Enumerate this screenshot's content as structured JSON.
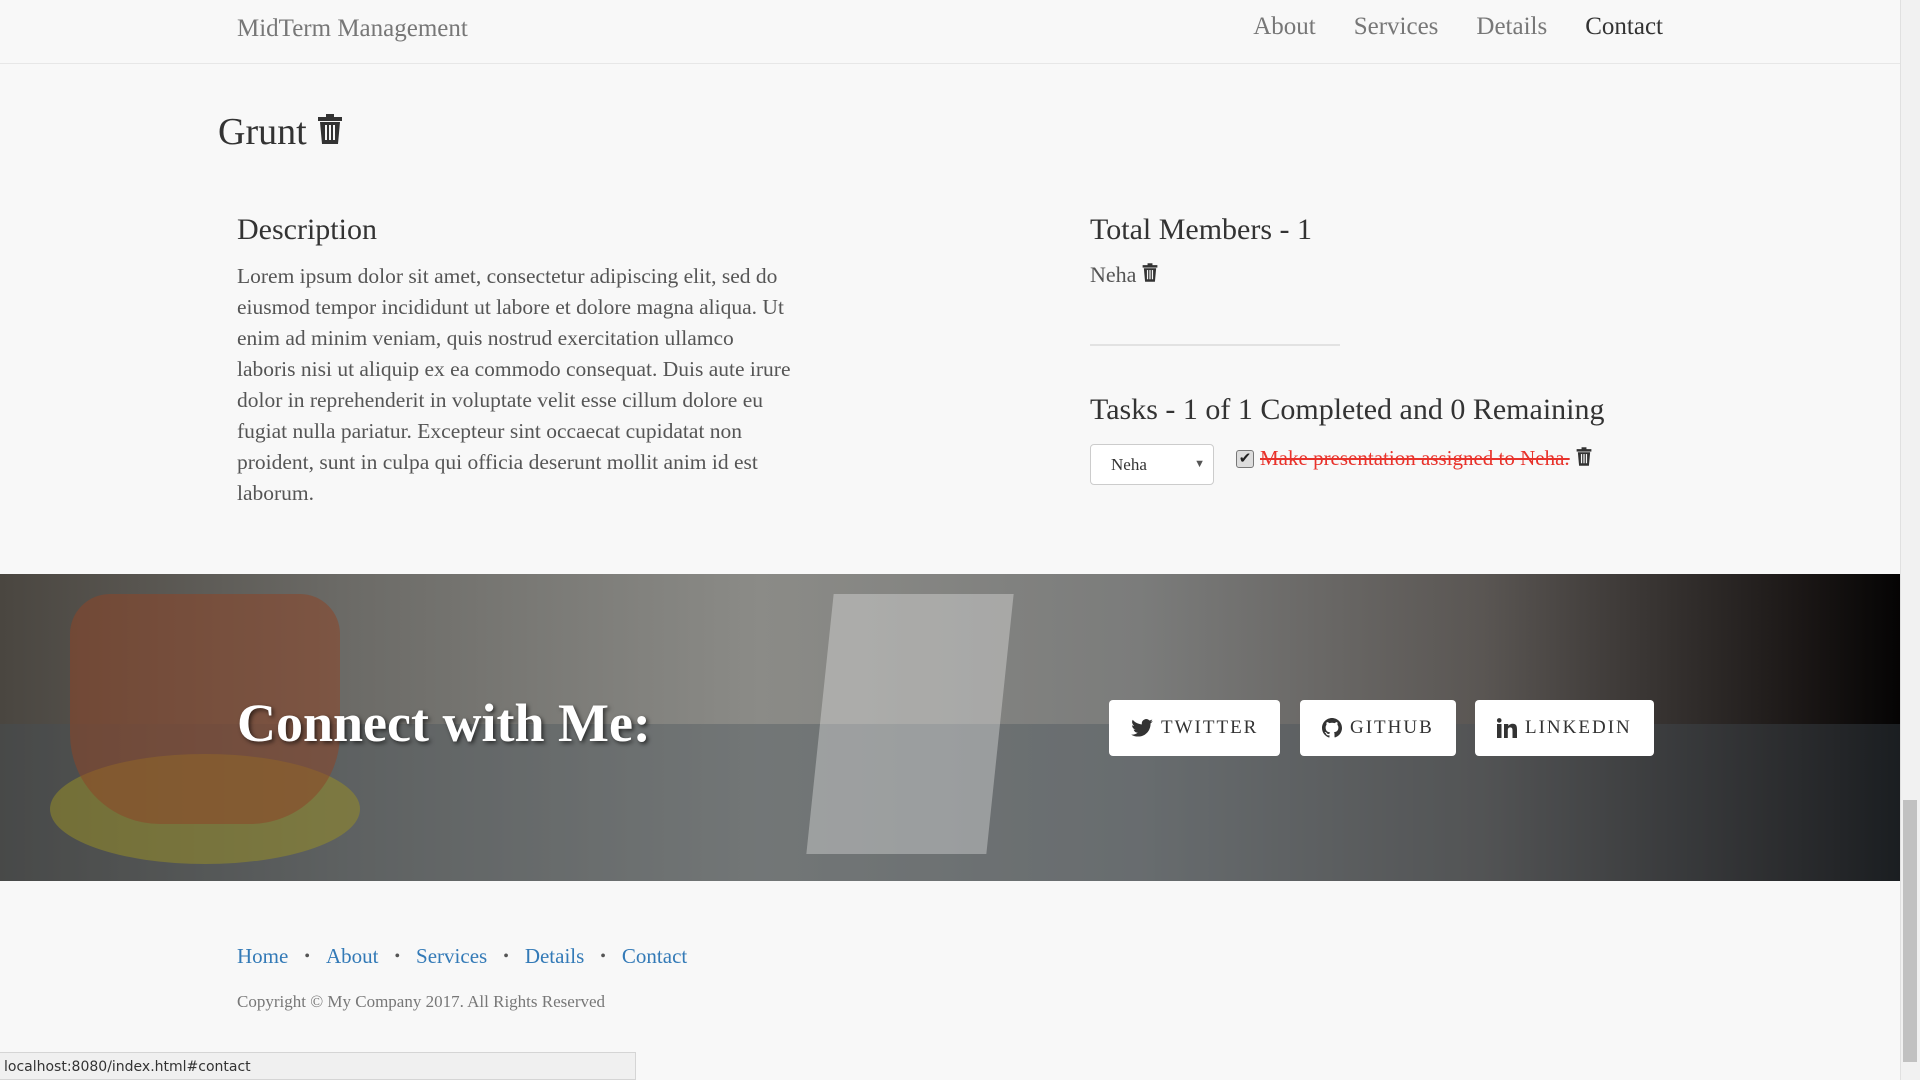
{
  "nav": {
    "brand": "MidTerm Management",
    "links": [
      "About",
      "Services",
      "Details",
      "Contact"
    ],
    "active": "Contact"
  },
  "project": {
    "title": "Grunt",
    "description_heading": "Description",
    "description": "Lorem ipsum dolor sit amet, consectetur adipiscing elit, sed do eiusmod tempor incididunt ut labore et dolore magna aliqua. Ut enim ad minim veniam, quis nostrud exercitation ullamco laboris nisi ut aliquip ex ea commodo consequat. Duis aute irure dolor in reprehenderit in voluptate velit esse cillum dolore eu fugiat nulla pariatur. Excepteur sint occaecat cupidatat non proident, sunt in culpa qui officia deserunt mollit anim id est laborum.",
    "members_heading": "Total Members - 1",
    "members": [
      "Neha"
    ],
    "tasks_heading": "Tasks - 1 of 1 Completed and 0 Remaining",
    "assignee_select": "Neha",
    "tasks": [
      {
        "text": "Make presentation assigned to Neha.",
        "completed": true
      }
    ]
  },
  "banner": {
    "heading": "Connect with Me:",
    "buttons": [
      "TWITTER",
      "GITHUB",
      "LINKEDIN"
    ]
  },
  "footer": {
    "links": [
      "Home",
      "About",
      "Services",
      "Details",
      "Contact"
    ],
    "copyright": "Copyright © My Company 2017. All Rights Reserved"
  },
  "status_bar": "localhost:8080/index.html#contact",
  "colors": {
    "link": "#337ab7",
    "completed_task": "#e8322b",
    "background": "#f8f8f8"
  }
}
